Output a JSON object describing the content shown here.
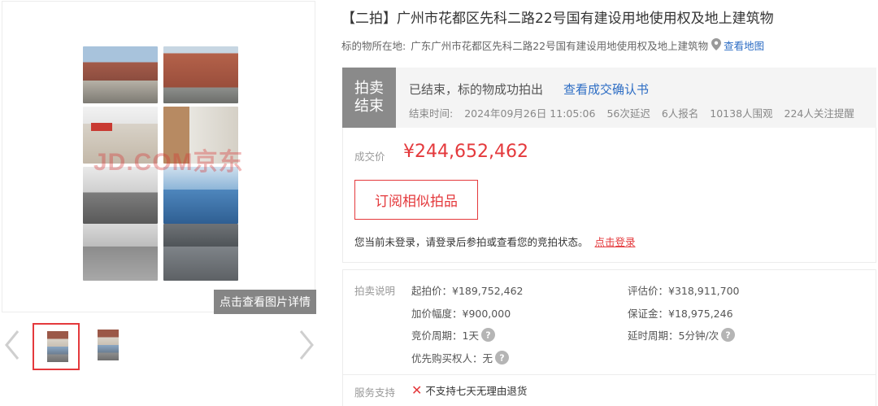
{
  "gallery": {
    "watermark": "JD.COM京东",
    "detail_button": "点击查看图片详情",
    "thumbnails": [
      {
        "icon": "property-photo-thumbnail",
        "selected": true
      },
      {
        "icon": "property-photo-thumbnail",
        "selected": false
      }
    ]
  },
  "listing": {
    "title": "【二拍】广州市花都区先科二路22号国有建设用地使用权及地上建筑物",
    "location_label": "标的物所在地:",
    "location_value": "广东广州市花都区先科二路22号国有建设用地使用权及地上建筑物",
    "map_link": "查看地图"
  },
  "status": {
    "badge_line1": "拍卖",
    "badge_line2": "结束",
    "message": "已结束，标的物成功拍出",
    "confirm_link": "查看成交确认书",
    "end_time_label": "结束时间:",
    "end_time": "2024年09月26日 11:05:06",
    "delays": "56次延迟",
    "signups": "6人报名",
    "viewers": "10138人围观",
    "watchers": "224人关注提醒"
  },
  "deal": {
    "label": "成交价",
    "price": "¥244,652,462",
    "subscribe_button": "订阅相似拍品",
    "login_text": "您当前未登录，请登录后参拍或查看您的竞拍状态。",
    "login_link": "点击登录"
  },
  "terms": {
    "label": "拍卖说明",
    "start_price": "起拍价：¥189,752,462",
    "appraisal": "评估价：¥318,911,700",
    "increment": "加价幅度：¥900,000",
    "deposit": "保证金：¥18,975,246",
    "cycle": "竞价周期：1天",
    "extension": "延时周期：5分钟/次",
    "priority": "优先购买权人：无",
    "service_label": "服务支持",
    "service_item": "不支持七天无理由退货"
  },
  "colors": {
    "accent_red": "#e4393c",
    "link_blue": "#2d6dc4",
    "status_gray": "#8a8a8a"
  }
}
